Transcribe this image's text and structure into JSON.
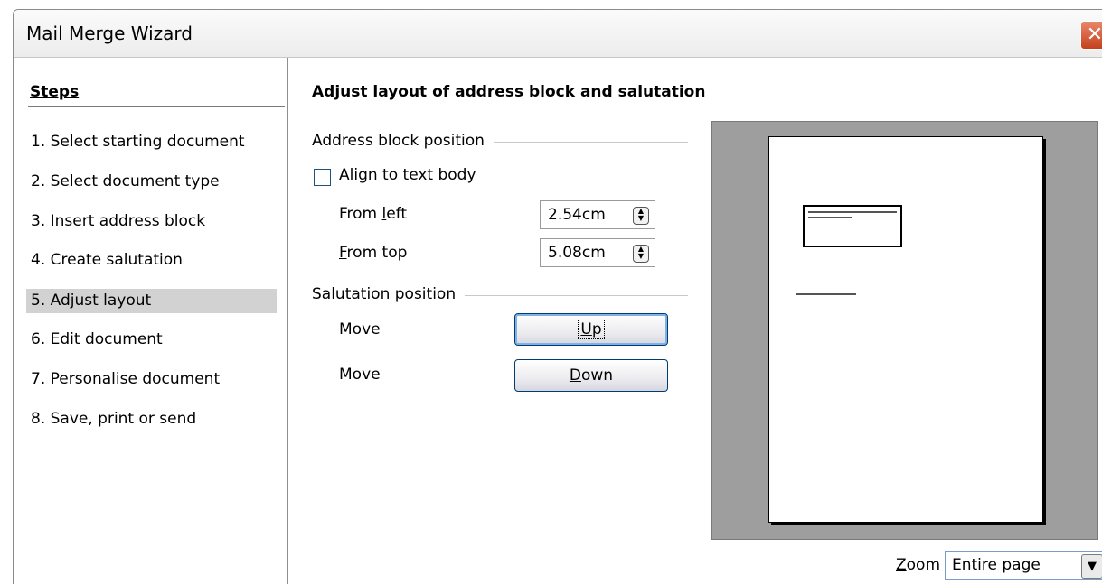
{
  "window": {
    "title": "Mail Merge Wizard",
    "close_glyph": "✕"
  },
  "steps": {
    "heading": "Steps",
    "items": [
      {
        "label": "1.  Select starting document"
      },
      {
        "label": "2.  Select document type"
      },
      {
        "label": "3.  Insert address block"
      },
      {
        "label": "4.  Create salutation"
      },
      {
        "label": "5.  Adjust layout"
      },
      {
        "label": "6.  Edit document"
      },
      {
        "label": "7.  Personalise document"
      },
      {
        "label": "8.  Save, print or send"
      }
    ],
    "active_index": 4
  },
  "main": {
    "heading": "Adjust layout of address block and salutation",
    "address_block": {
      "group_label": "Address block position",
      "align_checkbox": {
        "label_mnemonic": "A",
        "label_rest": "lign to text body",
        "checked": false
      },
      "from_left": {
        "label_pre": "From ",
        "label_mnemonic": "l",
        "label_rest": "eft",
        "value": "2.54cm"
      },
      "from_top": {
        "label_mnemonic": "F",
        "label_rest": "rom top",
        "value": "5.08cm"
      }
    },
    "salutation": {
      "group_label": "Salutation position",
      "move_up": {
        "label": "Move",
        "button_mnemonic": "U",
        "button_rest": "p"
      },
      "move_down": {
        "label": "Move",
        "button_mnemonic": "D",
        "button_rest": "own"
      }
    },
    "preview": {
      "zoom_label_mnemonic": "Z",
      "zoom_label_rest": "oom",
      "zoom_value": "Entire page",
      "dropdown_glyph": "▼"
    }
  }
}
